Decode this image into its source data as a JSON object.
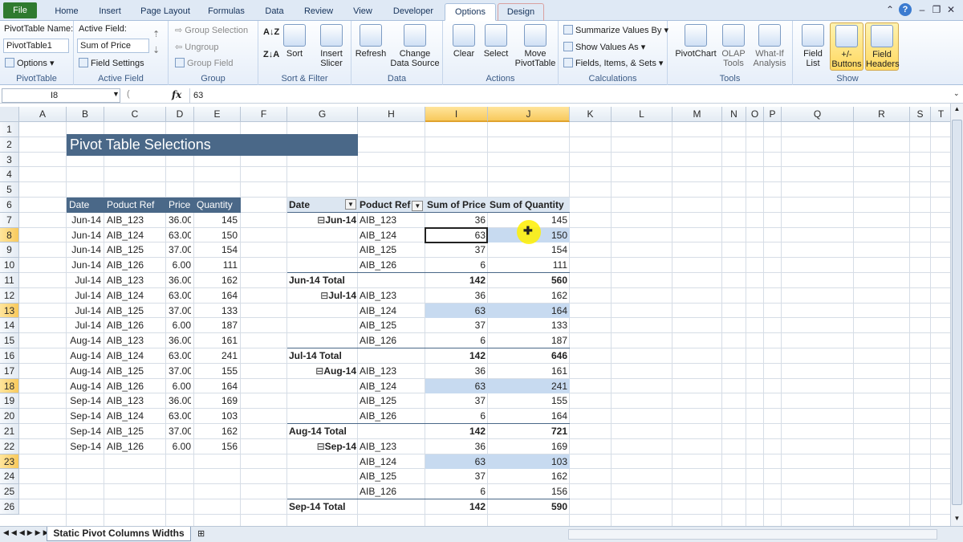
{
  "tabs": [
    "File",
    "Home",
    "Insert",
    "Page Layout",
    "Formulas",
    "Data",
    "Review",
    "View",
    "Developer",
    "Options",
    "Design"
  ],
  "ribbon": {
    "pivottable": {
      "name_label": "PivotTable Name:",
      "name_value": "PivotTable1",
      "options": "Options",
      "group": "PivotTable"
    },
    "active_field": {
      "label": "Active Field:",
      "value": "Sum of Price",
      "settings": "Field Settings",
      "group": "Active Field"
    },
    "group": {
      "group_selection": "Group Selection",
      "ungroup": "Ungroup",
      "group_field": "Group Field",
      "group": "Group"
    },
    "sort_filter": {
      "sort": "Sort",
      "insert_slicer": "Insert Slicer",
      "group": "Sort & Filter"
    },
    "data": {
      "refresh": "Refresh",
      "change_source": "Change Data Source",
      "group": "Data"
    },
    "actions": {
      "clear": "Clear",
      "select": "Select",
      "move": "Move PivotTable",
      "group": "Actions"
    },
    "calculations": {
      "summarize": "Summarize Values By",
      "show_values": "Show Values As",
      "fields_items": "Fields, Items, & Sets",
      "group": "Calculations"
    },
    "tools": {
      "pivotchart": "PivotChart",
      "olap": "OLAP Tools",
      "whatif": "What-If Analysis",
      "group": "Tools"
    },
    "show": {
      "field_list": "Field List",
      "buttons": "+/- Buttons",
      "headers": "Field Headers",
      "group": "Show"
    }
  },
  "formula_bar": {
    "cell": "I8",
    "fx": "fx",
    "value": "63"
  },
  "columns": [
    "A",
    "B",
    "C",
    "D",
    "E",
    "F",
    "G",
    "H",
    "I",
    "J",
    "K",
    "L",
    "M",
    "N",
    "O",
    "P",
    "Q",
    "R",
    "S",
    "T"
  ],
  "rows": [
    "1",
    "2",
    "3",
    "4",
    "5",
    "6",
    "7",
    "8",
    "9",
    "10",
    "11",
    "12",
    "13",
    "14",
    "15",
    "16",
    "17",
    "18",
    "19",
    "20",
    "21",
    "22",
    "23",
    "24",
    "25",
    "26"
  ],
  "sheet_title": "Pivot Table Selections",
  "source_table": {
    "headers": [
      "Date",
      "Poduct Ref",
      "Price",
      "Quantity"
    ],
    "rows": [
      [
        "Jun-14",
        "AIB_123",
        "36.00",
        "145"
      ],
      [
        "Jun-14",
        "AIB_124",
        "63.00",
        "150"
      ],
      [
        "Jun-14",
        "AIB_125",
        "37.00",
        "154"
      ],
      [
        "Jun-14",
        "AIB_126",
        "6.00",
        "111"
      ],
      [
        "Jul-14",
        "AIB_123",
        "36.00",
        "162"
      ],
      [
        "Jul-14",
        "AIB_124",
        "63.00",
        "164"
      ],
      [
        "Jul-14",
        "AIB_125",
        "37.00",
        "133"
      ],
      [
        "Jul-14",
        "AIB_126",
        "6.00",
        "187"
      ],
      [
        "Aug-14",
        "AIB_123",
        "36.00",
        "161"
      ],
      [
        "Aug-14",
        "AIB_124",
        "63.00",
        "241"
      ],
      [
        "Aug-14",
        "AIB_125",
        "37.00",
        "155"
      ],
      [
        "Aug-14",
        "AIB_126",
        "6.00",
        "164"
      ],
      [
        "Sep-14",
        "AIB_123",
        "36.00",
        "169"
      ],
      [
        "Sep-14",
        "AIB_124",
        "63.00",
        "103"
      ],
      [
        "Sep-14",
        "AIB_125",
        "37.00",
        "162"
      ],
      [
        "Sep-14",
        "AIB_126",
        "6.00",
        "156"
      ]
    ]
  },
  "pivot": {
    "headers": [
      "Date",
      "Poduct Ref",
      "Sum of Price",
      "Sum of Quantity"
    ],
    "rows": [
      {
        "g": "Jun-14",
        "h": "AIB_123",
        "i": "36",
        "j": "145"
      },
      {
        "g": "",
        "h": "AIB_124",
        "i": "63",
        "j": "150"
      },
      {
        "g": "",
        "h": "AIB_125",
        "i": "37",
        "j": "154"
      },
      {
        "g": "",
        "h": "AIB_126",
        "i": "6",
        "j": "111"
      },
      {
        "g": "Jun-14 Total",
        "h": "",
        "i": "142",
        "j": "560"
      },
      {
        "g": "Jul-14",
        "h": "AIB_123",
        "i": "36",
        "j": "162"
      },
      {
        "g": "",
        "h": "AIB_124",
        "i": "63",
        "j": "164"
      },
      {
        "g": "",
        "h": "AIB_125",
        "i": "37",
        "j": "133"
      },
      {
        "g": "",
        "h": "AIB_126",
        "i": "6",
        "j": "187"
      },
      {
        "g": "Jul-14 Total",
        "h": "",
        "i": "142",
        "j": "646"
      },
      {
        "g": "Aug-14",
        "h": "AIB_123",
        "i": "36",
        "j": "161"
      },
      {
        "g": "",
        "h": "AIB_124",
        "i": "63",
        "j": "241"
      },
      {
        "g": "",
        "h": "AIB_125",
        "i": "37",
        "j": "155"
      },
      {
        "g": "",
        "h": "AIB_126",
        "i": "6",
        "j": "164"
      },
      {
        "g": "Aug-14 Total",
        "h": "",
        "i": "142",
        "j": "721"
      },
      {
        "g": "Sep-14",
        "h": "AIB_123",
        "i": "36",
        "j": "169"
      },
      {
        "g": "",
        "h": "AIB_124",
        "i": "63",
        "j": "103"
      },
      {
        "g": "",
        "h": "AIB_125",
        "i": "37",
        "j": "162"
      },
      {
        "g": "",
        "h": "AIB_126",
        "i": "6",
        "j": "156"
      },
      {
        "g": "Sep-14 Total",
        "h": "",
        "i": "142",
        "j": "590"
      }
    ]
  },
  "sheet_tab": "Static Pivot Columns Widths",
  "colors": {
    "header": "#4a6888",
    "highlight": "#c7daf0",
    "selected_header": "#f8c95c"
  }
}
